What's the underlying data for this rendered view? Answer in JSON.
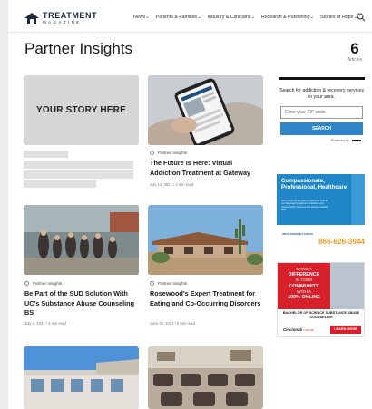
{
  "header": {
    "logo_line1": "TREATMENT",
    "logo_line2": "MAGAZINE",
    "nav": [
      "News",
      "Patients & Families",
      "Industry & Clinicians",
      "Research & Publishing",
      "Stories of Hope"
    ],
    "nav_caret": "⌄"
  },
  "page": {
    "title": "Partner Insights",
    "article_count": "6",
    "article_count_label": "Articles"
  },
  "placeholder_card": {
    "image_text": "YOUR STORY HERE"
  },
  "articles": [
    {
      "category": "Partner Insights",
      "title": "The Future Is Here: Virtual Addiction Treatment at Gateway",
      "meta": "July 14, 2021 / 4 min read"
    },
    {
      "category": "Partner Insights",
      "title": "Be Part of the SUD Solution With UC's Substance Abuse Counseling BS",
      "meta": "July 7, 2021 / 4 min read"
    },
    {
      "category": "Partner Insights",
      "title": "Rosewood's Expert Treatment for Eating and Co-Occurring Disorders",
      "meta": "June 25, 2021 / 5 min read"
    }
  ],
  "sidebar": {
    "zip_prompt": "Search for addiction & recovery services in your area.",
    "zip_placeholder": "Enter your ZIP code",
    "search_label": "SEARCH",
    "powered_by": "Powered by"
  },
  "ad1": {
    "headline": "Compassionate, Professional, Healthcare",
    "body": "We provide whole-person healthcare through our integrated programs of addiction and mental health treatment and primary medical care.",
    "org": "INDIAN RIVER/HELP CENTER",
    "phone": "866-626-3944",
    "colors": {
      "bg": "#1f86c7",
      "phone": "#f39a1e"
    }
  },
  "ad2": {
    "line1": "MAKE A",
    "line2": "DIFFERENCE",
    "line3": "IN YOUR",
    "line4": "COMMUNITY",
    "line5": "WITH A",
    "line6": "100% ONLINE",
    "degree": "BACHELOR OF SCIENCE SUBSTANCE ABUSE COUNSELING",
    "school": "Cincinnati",
    "school_suffix": "ONLINE",
    "cta": "LEARN MORE",
    "colors": {
      "bg": "#d7202b"
    }
  }
}
